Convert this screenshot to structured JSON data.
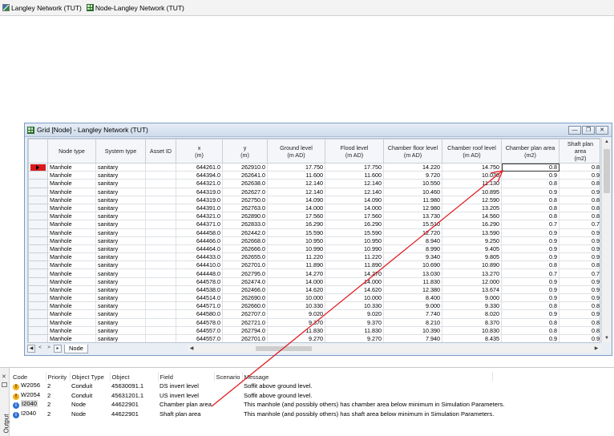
{
  "doc_tabs": [
    {
      "label": "Langley Network (TUT)",
      "icon": "network-icon"
    },
    {
      "label": "Node-Langley Network (TUT)",
      "icon": "grid-icon"
    }
  ],
  "grid_window": {
    "title": "Grid [Node] - Langley Network (TUT)",
    "buttons": {
      "minimize": "—",
      "restore": "❐",
      "close": "✕"
    },
    "columns": [
      {
        "line1": "Node type",
        "line2": ""
      },
      {
        "line1": "System type",
        "line2": ""
      },
      {
        "line1": "Asset ID",
        "line2": ""
      },
      {
        "line1": "x",
        "line2": "(m)"
      },
      {
        "line1": "y",
        "line2": "(m)"
      },
      {
        "line1": "Ground level",
        "line2": "(m AD)"
      },
      {
        "line1": "Flood level",
        "line2": "(m AD)"
      },
      {
        "line1": "Chamber floor level",
        "line2": "(m AD)"
      },
      {
        "line1": "Chamber roof level",
        "line2": "(m AD)"
      },
      {
        "line1": "Chamber plan area",
        "line2": "(m2)"
      },
      {
        "line1": "Shaft plan area",
        "line2": "(m2)"
      }
    ],
    "rows": [
      [
        "Manhole",
        "sanitary",
        "",
        "644261.0",
        "262910.0",
        "17.750",
        "17.750",
        "14.220",
        "14.750",
        "0.8",
        "0.8"
      ],
      [
        "Manhole",
        "sanitary",
        "",
        "644394.0",
        "262641.0",
        "11.600",
        "11.600",
        "9.720",
        "10.030",
        "0.9",
        "0.9"
      ],
      [
        "Manhole",
        "sanitary",
        "",
        "644321.0",
        "262638.0",
        "12.140",
        "12.140",
        "10.550",
        "11.130",
        "0.8",
        "0.8"
      ],
      [
        "Manhole",
        "sanitary",
        "",
        "644319.0",
        "262627.0",
        "12.140",
        "12.140",
        "10.460",
        "10.895",
        "0.9",
        "0.9"
      ],
      [
        "Manhole",
        "sanitary",
        "",
        "644319.0",
        "262750.0",
        "14.090",
        "14.090",
        "11.980",
        "12.590",
        "0.8",
        "0.8"
      ],
      [
        "Manhole",
        "sanitary",
        "",
        "644391.0",
        "262763.0",
        "14.000",
        "14.000",
        "12.980",
        "13.205",
        "0.8",
        "0.8"
      ],
      [
        "Manhole",
        "sanitary",
        "",
        "644321.0",
        "262890.0",
        "17.560",
        "17.560",
        "13.730",
        "14.560",
        "0.8",
        "0.8"
      ],
      [
        "Manhole",
        "sanitary",
        "",
        "644371.0",
        "262833.0",
        "16.290",
        "16.290",
        "15.510",
        "16.290",
        "0.7",
        "0.7"
      ],
      [
        "Manhole",
        "sanitary",
        "",
        "644458.0",
        "262442.0",
        "15.590",
        "15.590",
        "12.720",
        "13.590",
        "0.9",
        "0.9"
      ],
      [
        "Manhole",
        "sanitary",
        "",
        "644466.0",
        "262668.0",
        "10.950",
        "10.950",
        "8.940",
        "9.250",
        "0.9",
        "0.9"
      ],
      [
        "Manhole",
        "sanitary",
        "",
        "644464.0",
        "262666.0",
        "10.990",
        "10.990",
        "8.990",
        "9.405",
        "0.9",
        "0.9"
      ],
      [
        "Manhole",
        "sanitary",
        "",
        "644433.0",
        "262655.0",
        "11.220",
        "11.220",
        "9.340",
        "9.805",
        "0.9",
        "0.9"
      ],
      [
        "Manhole",
        "sanitary",
        "",
        "644410.0",
        "262701.0",
        "11.890",
        "11.890",
        "10.690",
        "10.890",
        "0.8",
        "0.8"
      ],
      [
        "Manhole",
        "sanitary",
        "",
        "644448.0",
        "262795.0",
        "14.270",
        "14.270",
        "13.030",
        "13.270",
        "0.7",
        "0.7"
      ],
      [
        "Manhole",
        "sanitary",
        "",
        "644578.0",
        "262474.0",
        "14.000",
        "14.000",
        "11.830",
        "12.000",
        "0.9",
        "0.9"
      ],
      [
        "Manhole",
        "sanitary",
        "",
        "644538.0",
        "262466.0",
        "14.620",
        "14.620",
        "12.380",
        "13.674",
        "0.9",
        "0.9"
      ],
      [
        "Manhole",
        "sanitary",
        "",
        "644514.0",
        "262690.0",
        "10.000",
        "10.000",
        "8.400",
        "9.000",
        "0.9",
        "0.9"
      ],
      [
        "Manhole",
        "sanitary",
        "",
        "644571.0",
        "262660.0",
        "10.330",
        "10.330",
        "9.000",
        "9.330",
        "0.8",
        "0.8"
      ],
      [
        "Manhole",
        "sanitary",
        "",
        "644580.0",
        "262707.0",
        "9.020",
        "9.020",
        "7.740",
        "8.020",
        "0.9",
        "0.9"
      ],
      [
        "Manhole",
        "sanitary",
        "",
        "644578.0",
        "262721.0",
        "9.370",
        "9.370",
        "8.210",
        "8.370",
        "0.8",
        "0.8"
      ],
      [
        "Manhole",
        "sanitary",
        "",
        "644557.0",
        "262794.0",
        "11.830",
        "11.830",
        "10.390",
        "10.830",
        "0.8",
        "0.8"
      ],
      [
        "Manhole",
        "sanitary",
        "",
        "644557.0",
        "262701.0",
        "9.270",
        "9.270",
        "7.940",
        "8.435",
        "0.9",
        "0.9"
      ]
    ],
    "sheet_tab": "Node",
    "nav": {
      "first": "◀",
      "prev": "<",
      "next": ">",
      "last": "▸"
    }
  },
  "output": {
    "side_label": "Output",
    "headers": {
      "code": "Code",
      "priority": "Priority",
      "object_type": "Object Type",
      "object": "Object",
      "field": "Field",
      "scenario": "Scenario",
      "message": "Message"
    },
    "rows": [
      {
        "icon": "warning-icon",
        "code": "W2056",
        "priority": "2",
        "object_type": "Conduit",
        "object": "45630091.1",
        "field": "DS invert level",
        "scenario": "",
        "message": "Soffit above ground level."
      },
      {
        "icon": "warning-icon",
        "code": "W2054",
        "priority": "2",
        "object_type": "Conduit",
        "object": "45631201.1",
        "field": "US invert level",
        "scenario": "",
        "message": "Soffit above ground level."
      },
      {
        "icon": "info-icon",
        "code": "I2040",
        "priority": "2",
        "object_type": "Node",
        "object": "44622901",
        "field": "Chamber plan area",
        "scenario": "",
        "message": "This manhole (and possibly others) has chamber area below minimum in Simulation Parameters."
      },
      {
        "icon": "info-icon",
        "code": "I2040",
        "priority": "2",
        "object_type": "Node",
        "object": "44622901",
        "field": "Shaft plan area",
        "scenario": "",
        "message": "This manhole (and possibly others) has shaft area below minimum in Simulation Parameters."
      }
    ]
  },
  "colors": {
    "annotation_arrow": "#e0151b",
    "row_marker": "#d91a1a",
    "warning": "#f2b01e",
    "info": "#2f6fd1"
  }
}
